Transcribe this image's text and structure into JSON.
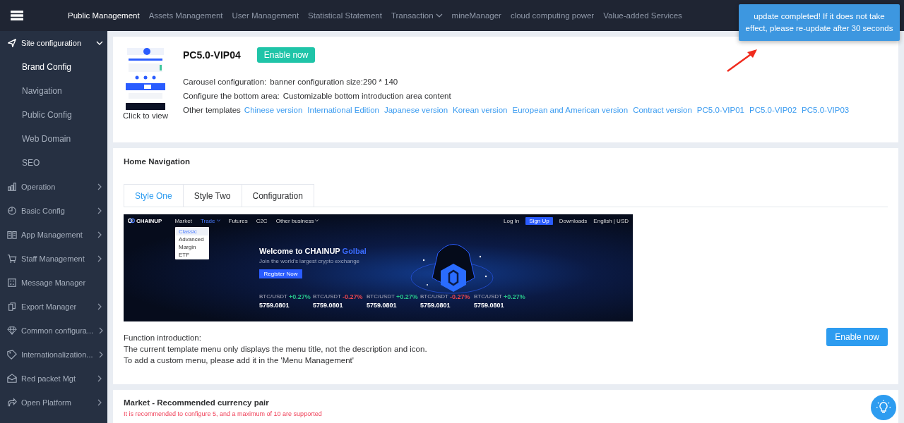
{
  "top_nav": {
    "items": [
      {
        "label": "Public Management",
        "selected": true,
        "dropdown": false
      },
      {
        "label": "Assets Management",
        "selected": false,
        "dropdown": false
      },
      {
        "label": "User Management",
        "selected": false,
        "dropdown": false
      },
      {
        "label": "Statistical Statement",
        "selected": false,
        "dropdown": false
      },
      {
        "label": "Transaction",
        "selected": false,
        "dropdown": true
      },
      {
        "label": "mineManager",
        "selected": false,
        "dropdown": false
      },
      {
        "label": "cloud computing power",
        "selected": false,
        "dropdown": false
      },
      {
        "label": "Value-added Services",
        "selected": false,
        "dropdown": false
      }
    ]
  },
  "toast": {
    "message": "update completed! If it does not take effect, please re-update after 30 seconds"
  },
  "sidebar": {
    "items": [
      {
        "label": "Site configuration",
        "kind": "group",
        "expanded": true,
        "children": [
          {
            "label": "Brand Config",
            "selected": true
          },
          {
            "label": "Navigation",
            "selected": false
          },
          {
            "label": "Public Config",
            "selected": false
          },
          {
            "label": "Web Domain",
            "selected": false
          },
          {
            "label": "SEO",
            "selected": false
          }
        ]
      },
      {
        "label": "Operation",
        "kind": "group",
        "expanded": false
      },
      {
        "label": "Basic Config",
        "kind": "group",
        "expanded": false
      },
      {
        "label": "App Management",
        "kind": "group",
        "expanded": false
      },
      {
        "label": "Staff Management",
        "kind": "group",
        "expanded": false
      },
      {
        "label": "Message Manager",
        "kind": "link"
      },
      {
        "label": "Export Manager",
        "kind": "group",
        "expanded": false
      },
      {
        "label": "Common configura...",
        "kind": "group",
        "expanded": false
      },
      {
        "label": "Internationalization...",
        "kind": "group",
        "expanded": false
      },
      {
        "label": "Red packet Mgt",
        "kind": "group",
        "expanded": false
      },
      {
        "label": "Open Platform",
        "kind": "group",
        "expanded": false
      }
    ]
  },
  "template_card": {
    "thumbnail_caption": "Click to view",
    "name": "PC5.0-VIP04",
    "enable_button": "Enable now",
    "lines": [
      {
        "label": "Carousel configuration:",
        "value": "banner configuration size:290 * 140"
      },
      {
        "label": "Configure the bottom area:",
        "value": "Customizable bottom introduction area content"
      }
    ],
    "other_templates_label": "Other templates",
    "other_templates": [
      "Chinese version",
      "International Edition",
      "Japanese version",
      "Korean version",
      "European and American version",
      "Contract version",
      "PC5.0-VIP01",
      "PC5.0-VIP02",
      "PC5.0-VIP03"
    ]
  },
  "home_navigation": {
    "title": "Home Navigation",
    "tabs": [
      {
        "label": "Style One",
        "selected": true
      },
      {
        "label": "Style Two",
        "selected": false
      },
      {
        "label": "Configuration",
        "selected": false
      }
    ],
    "preview": {
      "logo": "CHAINUP",
      "nav": [
        {
          "label": "Market",
          "selected": false,
          "dropdown": false
        },
        {
          "label": "Trade",
          "selected": true,
          "dropdown": true
        },
        {
          "label": "Futures",
          "selected": false,
          "dropdown": false
        },
        {
          "label": "C2C",
          "selected": false,
          "dropdown": false
        },
        {
          "label": "Other business",
          "selected": false,
          "dropdown": true
        }
      ],
      "menu": [
        {
          "label": "Classic",
          "selected": true
        },
        {
          "label": "Advanced",
          "selected": false
        },
        {
          "label": "Margin",
          "selected": false
        },
        {
          "label": "ETF",
          "selected": false
        }
      ],
      "right_nav": {
        "login": "Log In",
        "signup": "Sign Up",
        "downloads": "Downloads",
        "locale": "English | USD"
      },
      "title": "Welcome to CHAINUP",
      "title_highlight": "Golbal",
      "subtitle": "Join the world's largest crypto exchange",
      "register_button": "Register Now",
      "tickers": [
        {
          "pair": "BTC/USDT",
          "change": "+0.27%",
          "color": "#27c28a",
          "price": "5759.0801"
        },
        {
          "pair": "BTC/USDT",
          "change": "-0.27%",
          "color": "#e8454f",
          "price": "5759.0801"
        },
        {
          "pair": "BTC/USDT",
          "change": "+0.27%",
          "color": "#27c28a",
          "price": "5759.0801"
        },
        {
          "pair": "BTC/USDT",
          "change": "-0.27%",
          "color": "#e8454f",
          "price": "5759.0801"
        },
        {
          "pair": "BTC/USDT",
          "change": "+0.27%",
          "color": "#27c28a",
          "price": "5759.0801"
        }
      ]
    },
    "intro_lines": [
      "Function introduction:",
      "The current template menu only displays the menu title, not the description and icon.",
      "To add a custom menu, please add it in the 'Menu Management'"
    ],
    "enable_button": "Enable now"
  },
  "market": {
    "title": "Market - Recommended currency pair",
    "note": "It is recommended to configure 5, and a maximum of 10 are supported"
  }
}
